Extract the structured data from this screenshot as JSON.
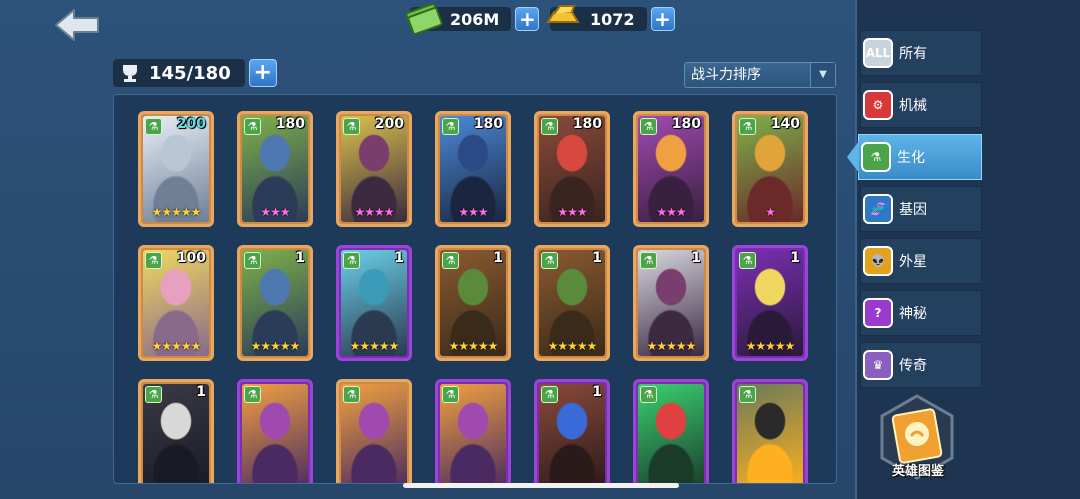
{
  "resources": {
    "cash": "206M",
    "gold": "1072",
    "plus": "+"
  },
  "capacity": {
    "value": "145/180",
    "plus": "+"
  },
  "sort": {
    "label": "战斗力排序",
    "arrow": "▼"
  },
  "filters": [
    {
      "label": "所有",
      "icon": "ALL",
      "icon_name": "all-icon",
      "color": "#c9d3dc",
      "active": false
    },
    {
      "label": "机械",
      "icon": "⚙",
      "icon_name": "mechanical-icon",
      "color": "#d9383a",
      "active": false
    },
    {
      "label": "生化",
      "icon": "⚗",
      "icon_name": "biochem-icon",
      "color": "#4ca44a",
      "active": true
    },
    {
      "label": "基因",
      "icon": "🧬",
      "icon_name": "gene-icon",
      "color": "#2d78c8",
      "active": false
    },
    {
      "label": "外星",
      "icon": "👽",
      "icon_name": "alien-icon",
      "color": "#e3a21a",
      "active": false
    },
    {
      "label": "神秘",
      "icon": "?",
      "icon_name": "mystery-icon",
      "color": "#9a3ad0",
      "active": false
    },
    {
      "label": "传奇",
      "icon": "♛",
      "icon_name": "legend-icon",
      "color": "#8a5fc0",
      "active": false
    }
  ],
  "codex": {
    "label": "英雄图鉴"
  },
  "heroes": [
    {
      "level": "200",
      "stars": "★★★★★",
      "star_color": "gold",
      "frame": "orange",
      "teal": true,
      "art": [
        "#e8eef6",
        "#b9c6d6",
        "#6e7f96"
      ]
    },
    {
      "level": "180",
      "stars": "★★★",
      "star_color": "pink",
      "frame": "orange",
      "teal": false,
      "art": [
        "#7fb04a",
        "#4d78b0",
        "#2a3c58"
      ]
    },
    {
      "level": "200",
      "stars": "★★★★",
      "star_color": "pink",
      "frame": "orange",
      "teal": false,
      "art": [
        "#d9c14a",
        "#7a3e6e",
        "#3b2a40"
      ]
    },
    {
      "level": "180",
      "stars": "★★★",
      "star_color": "pink",
      "frame": "orange",
      "teal": false,
      "art": [
        "#4c89d8",
        "#2b4a86",
        "#1a2640"
      ]
    },
    {
      "level": "180",
      "stars": "★★★",
      "star_color": "pink",
      "frame": "orange",
      "teal": false,
      "art": [
        "#8a4a3a",
        "#d8483e",
        "#3a2420"
      ]
    },
    {
      "level": "180",
      "stars": "★★★",
      "star_color": "pink",
      "frame": "orange",
      "teal": false,
      "art": [
        "#a04ab0",
        "#f0a040",
        "#3a2040"
      ]
    },
    {
      "level": "140",
      "stars": "★",
      "star_color": "pink",
      "frame": "orange",
      "teal": false,
      "art": [
        "#7fb04a",
        "#e0a43a",
        "#6a2a2a"
      ]
    },
    {
      "level": "100",
      "stars": "★★★★★",
      "star_color": "gold",
      "frame": "orange",
      "teal": false,
      "art": [
        "#f0d860",
        "#e8a0c0",
        "#8a6a8a"
      ]
    },
    {
      "level": "1",
      "stars": "★★★★★",
      "star_color": "gold",
      "frame": "orange",
      "teal": false,
      "art": [
        "#7fb04a",
        "#4d78b0",
        "#2a3c58"
      ]
    },
    {
      "level": "1",
      "stars": "★★★★★",
      "star_color": "gold",
      "frame": "purple",
      "teal": false,
      "art": [
        "#6ad0e8",
        "#3a9ab8",
        "#2a3a50"
      ]
    },
    {
      "level": "1",
      "stars": "★★★★★",
      "star_color": "gold",
      "frame": "orange",
      "teal": false,
      "art": [
        "#8a5a30",
        "#5a8a3a",
        "#3a2a1a"
      ]
    },
    {
      "level": "1",
      "stars": "★★★★★",
      "star_color": "gold",
      "frame": "orange",
      "teal": false,
      "art": [
        "#8a5a30",
        "#5a8a3a",
        "#3a2a1a"
      ]
    },
    {
      "level": "1",
      "stars": "★★★★★",
      "star_color": "gold",
      "frame": "orange",
      "teal": false,
      "art": [
        "#d8d8e0",
        "#7a3e6e",
        "#3b2a40"
      ]
    },
    {
      "level": "1",
      "stars": "★★★★★",
      "star_color": "gold",
      "frame": "purple",
      "teal": false,
      "art": [
        "#7a2fb3",
        "#f0d860",
        "#2a1a3a"
      ]
    },
    {
      "level": "1",
      "stars": "",
      "star_color": "gold",
      "frame": "orange",
      "teal": false,
      "art": [
        "#3a3a48",
        "#d8d8d8",
        "#1a1a24"
      ]
    },
    {
      "level": "",
      "stars": "",
      "star_color": "gold",
      "frame": "purple",
      "teal": false,
      "art": [
        "#f0a040",
        "#a04ab0",
        "#4a2a60"
      ]
    },
    {
      "level": "",
      "stars": "",
      "star_color": "gold",
      "frame": "orange",
      "teal": false,
      "art": [
        "#f0a040",
        "#a04ab0",
        "#4a2a60"
      ]
    },
    {
      "level": "",
      "stars": "",
      "star_color": "gold",
      "frame": "purple",
      "teal": false,
      "art": [
        "#f0a040",
        "#a04ab0",
        "#4a2a60"
      ]
    },
    {
      "level": "1",
      "stars": "",
      "star_color": "gold",
      "frame": "purple",
      "teal": false,
      "art": [
        "#8a4a3a",
        "#3a6ad8",
        "#2a1a1a"
      ]
    },
    {
      "level": "",
      "stars": "",
      "star_color": "gold",
      "frame": "purple",
      "teal": false,
      "art": [
        "#3ad070",
        "#e04040",
        "#1a3a2a"
      ]
    },
    {
      "level": "",
      "stars": "",
      "star_color": "gold",
      "frame": "purple",
      "teal": false,
      "art": [
        "#6a7a5a",
        "#2a2a2a",
        "#ffb020"
      ]
    }
  ]
}
